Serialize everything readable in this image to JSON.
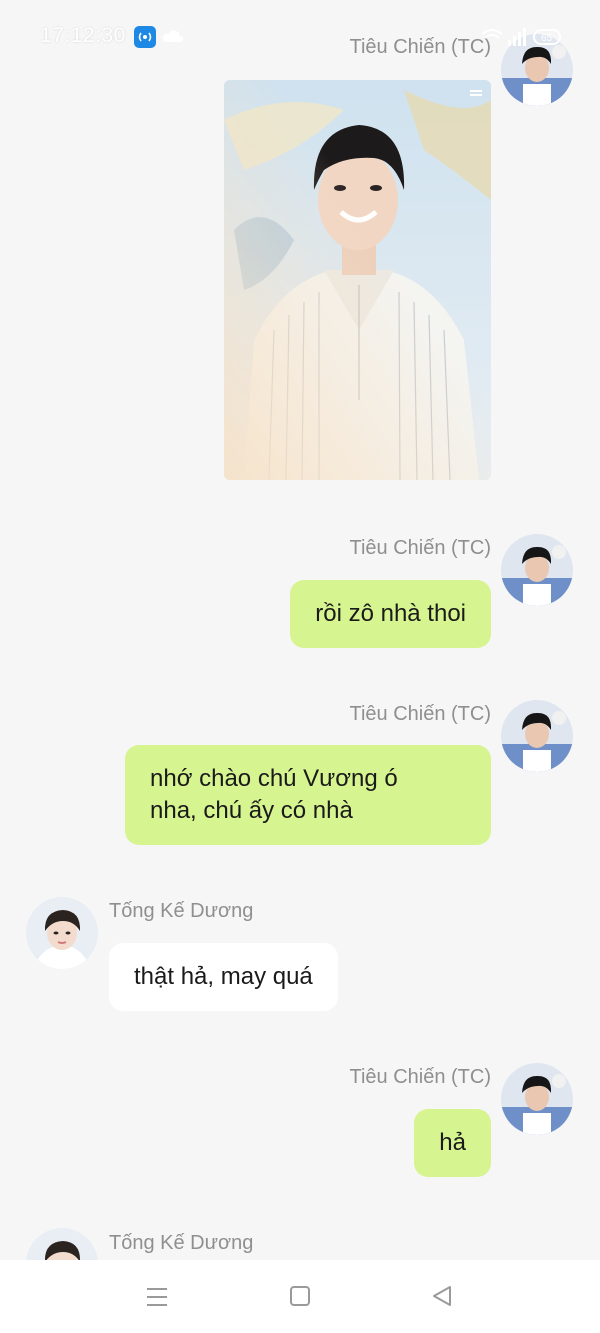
{
  "status_bar": {
    "time": "17:12:30",
    "icons": [
      "hotspot-icon",
      "cloud-icon",
      "wifi-icon",
      "signal-icon",
      "battery-icon"
    ]
  },
  "messages": [
    {
      "direction": "out",
      "sender": "Tiêu Chiến (TC)",
      "type": "image"
    },
    {
      "direction": "out",
      "sender": "Tiêu Chiến (TC)",
      "type": "text",
      "text": "rồi zô nhà thoi"
    },
    {
      "direction": "out",
      "sender": "Tiêu Chiến (TC)",
      "type": "text",
      "text_line1": "nhớ chào chú Vương ó",
      "text_line2": "nha, chú ấy có nhà"
    },
    {
      "direction": "in",
      "sender": "Tống Kế Dương",
      "type": "text",
      "text": "thật hả, may quá"
    },
    {
      "direction": "out",
      "sender": "Tiêu Chiến (TC)",
      "type": "text",
      "text": "hả"
    },
    {
      "direction": "in",
      "sender": "Tống Kế Dương",
      "type": "text"
    }
  ],
  "nav_bar": {
    "buttons": [
      "menu-icon",
      "home-icon",
      "back-icon"
    ]
  },
  "colors": {
    "background": "#f6f6f6",
    "outgoing_bubble": "#d6f48f",
    "incoming_bubble": "#ffffff",
    "sender_name": "#8f8f8f"
  }
}
